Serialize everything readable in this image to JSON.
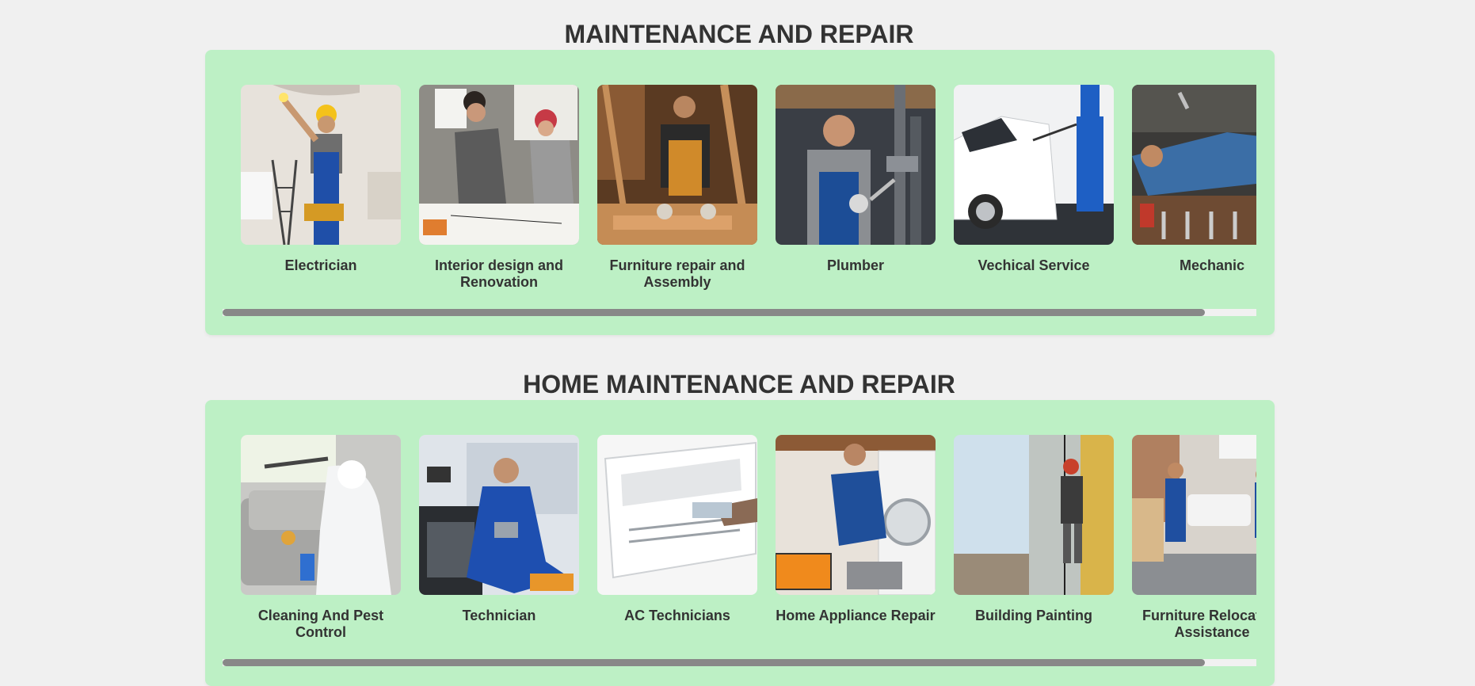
{
  "sections": [
    {
      "title": "MAINTENANCE AND REPAIR",
      "services": [
        {
          "label": "Electrician",
          "icon": "electrician-photo"
        },
        {
          "label": "Interior design and Renovation",
          "icon": "interior-design-photo"
        },
        {
          "label": "Furniture repair and Assembly",
          "icon": "furniture-repair-photo"
        },
        {
          "label": "Plumber",
          "icon": "plumber-photo"
        },
        {
          "label": "Vechical Service",
          "icon": "vehicle-service-photo"
        },
        {
          "label": "Mechanic",
          "icon": "mechanic-photo"
        }
      ]
    },
    {
      "title": "HOME MAINTENANCE AND REPAIR",
      "services": [
        {
          "label": "Cleaning And Pest Control",
          "icon": "cleaning-pest-control-photo"
        },
        {
          "label": "Technician",
          "icon": "technician-photo"
        },
        {
          "label": "AC Technicians",
          "icon": "ac-technician-photo"
        },
        {
          "label": "Home Appliance Repair",
          "icon": "home-appliance-repair-photo"
        },
        {
          "label": "Building Painting",
          "icon": "building-painting-photo"
        },
        {
          "label": "Furniture Relocation Assistance",
          "icon": "furniture-relocation-photo"
        }
      ]
    }
  ],
  "colors": {
    "page_background": "#f0f0f0",
    "panel_background": "#bdf0c5",
    "title_text": "#333333",
    "scroll_thumb": "#888888",
    "scroll_track": "#f1f1f1"
  }
}
